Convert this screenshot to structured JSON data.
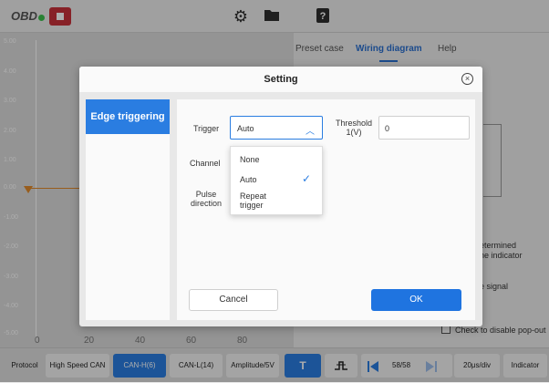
{
  "topbar": {
    "logo_text": "OBD",
    "icons": [
      "stop-icon",
      "gear-icon",
      "folder-icon",
      "help-icon"
    ]
  },
  "graph": {
    "y_labels": [
      "5.00",
      "4.00",
      "3.00",
      "2.00",
      "1.00",
      "0.00",
      "-1.00",
      "-2.00",
      "-3.00",
      "-4.00",
      "-5.00"
    ],
    "x_labels": [
      "0",
      "20",
      "40",
      "60",
      "80"
    ],
    "trace_color": "#e08a2c"
  },
  "right_panel": {
    "tabs": [
      "Preset case",
      "Wiring diagram",
      "Help"
    ],
    "active_tab": "Wiring diagram",
    "side_text_1a": "etermined",
    "side_text_1b": "he indicator",
    "side_text_2": "e signal",
    "popout_checkbox_label": "Check to disable pop-out"
  },
  "bottombar": {
    "protocol": "Protocol",
    "protocol_value": "High Speed CAN",
    "can_h": "CAN-H(6)",
    "can_l": "CAN-L(14)",
    "amplitude": "Amplitude/5V",
    "t_button": "T",
    "page": "58/58",
    "timebase": "20μs/div",
    "indicator": "Indicator"
  },
  "modal": {
    "title": "Setting",
    "menu_items": [
      "Edge triggering"
    ],
    "trigger_label": "Trigger",
    "trigger_value": "Auto",
    "threshold_label_1": "Threshold",
    "threshold_label_2": "1(V)",
    "threshold_value": "0",
    "channel_label": "Channel",
    "pulse_label_1": "Pulse",
    "pulse_label_2": "direction",
    "dropdown_options": [
      "None",
      "Auto",
      "Repeat",
      "trigger"
    ],
    "selected_option": "Auto",
    "cancel_label": "Cancel",
    "ok_label": "OK"
  },
  "colors": {
    "accent": "#2a7de1",
    "stop_red": "#c8323a"
  }
}
